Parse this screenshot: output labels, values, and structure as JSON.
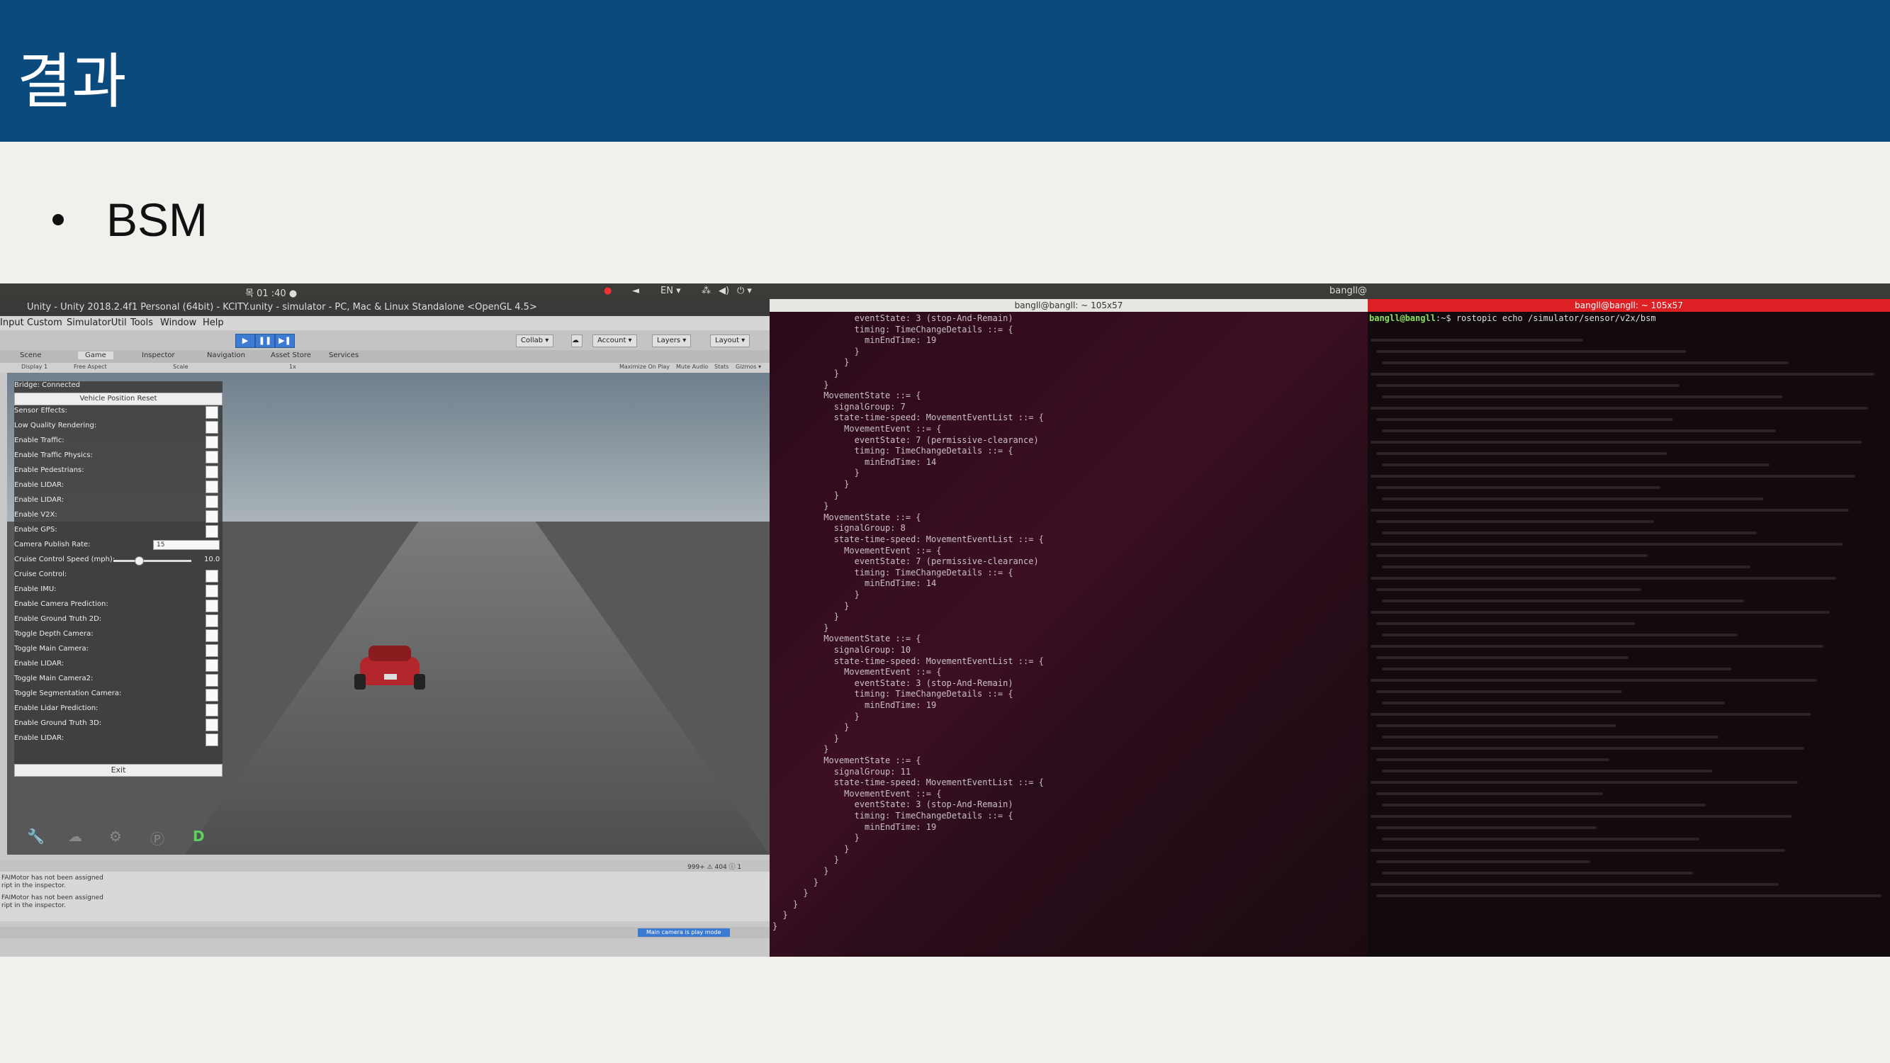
{
  "slide": {
    "title": "결과",
    "bullet": "BSM",
    "colors": {
      "header_bg": "#0b4a7d",
      "slide_bg": "#f2f0ec"
    }
  },
  "system_bar": {
    "clock": "목 01 :40 ●",
    "lang": "EN ▾",
    "right_user": "bangll@"
  },
  "unity": {
    "window_title": "Unity - Unity 2018.2.4f1 Personal (64bit) - KCITY.unity - simulator - PC, Mac & Linux Standalone <OpenGL 4.5>",
    "menu": [
      "Input",
      "Custom",
      "SimulatorUtil",
      "Tools",
      "Window",
      "Help"
    ],
    "toolbar": {
      "play": "▶",
      "pause": "❚❚",
      "step": "▶❚",
      "collab": "Collab ▾",
      "account": "Account ▾",
      "layers": "Layers ▾",
      "layout": "Layout ▾"
    },
    "tabs": [
      "Scene",
      "Game",
      "Inspector",
      "Navigation",
      "Asset Store",
      "Services"
    ],
    "active_tab": "Game",
    "game_sub": {
      "display": "Display 1",
      "aspect": "Free Aspect",
      "scale": "Scale",
      "scale_val": "1x",
      "maximize": "Maximize On Play",
      "mute": "Mute Audio",
      "stats": "Stats",
      "gizmos": "Gizmos ▾"
    },
    "panel": {
      "status": "Bridge: Connected",
      "reset": "Vehicle Position Reset",
      "options_a": [
        "Sensor Effects:",
        "Low Quality Rendering:",
        "Enable Traffic:",
        "Enable Traffic Physics:",
        "Enable Pedestrians:",
        "Enable LIDAR:",
        "Enable LIDAR:",
        "Enable V2X:",
        "Enable GPS:"
      ],
      "rate_label": "Camera Publish Rate:",
      "rate_value": "15",
      "speed_label": "Cruise Control Speed (mph):",
      "speed_value": "10.0",
      "options_b": [
        "Cruise Control:",
        "Enable IMU:",
        "Enable Camera Prediction:",
        "Enable Ground Truth 2D:",
        "Toggle Depth Camera:",
        "Toggle Main Camera:",
        "Enable LIDAR:",
        "Toggle Main Camera2:",
        "Toggle Segmentation Camera:",
        "Enable Lidar Prediction:",
        "Enable Ground Truth 3D:",
        "Enable LIDAR:"
      ],
      "exit": "Exit"
    },
    "bottom_tools": [
      "wrench-icon",
      "cloud-icon",
      "steering-icon",
      "parking-icon",
      "drive-icon"
    ],
    "bottom_tool_glyphs": [
      "🔧",
      "☁",
      "⚙",
      "Ⓟ",
      "D"
    ],
    "console": {
      "lines": [
        "FAIMotor has not been assigned",
        "ript in the inspector.",
        "FAIMotor has not been assigned",
        "ript in the inspector."
      ],
      "counts": "999+  ⚠ 404  ⓘ 1"
    },
    "status_badge": "Main camera is play mode"
  },
  "term1": {
    "title": "bangll@bangll: ~ 105x57",
    "lines": [
      "                eventState: 3 (stop-And-Remain)",
      "                timing: TimeChangeDetails ::= {",
      "                  minEndTime: 19",
      "                }",
      "              }",
      "            }",
      "          }",
      "          MovementState ::= {",
      "            signalGroup: 7",
      "            state-time-speed: MovementEventList ::= {",
      "              MovementEvent ::= {",
      "                eventState: 7 (permissive-clearance)",
      "                timing: TimeChangeDetails ::= {",
      "                  minEndTime: 14",
      "                }",
      "              }",
      "            }",
      "          }",
      "          MovementState ::= {",
      "            signalGroup: 8",
      "            state-time-speed: MovementEventList ::= {",
      "              MovementEvent ::= {",
      "                eventState: 7 (permissive-clearance)",
      "                timing: TimeChangeDetails ::= {",
      "                  minEndTime: 14",
      "                }",
      "              }",
      "            }",
      "          }",
      "          MovementState ::= {",
      "            signalGroup: 10",
      "            state-time-speed: MovementEventList ::= {",
      "              MovementEvent ::= {",
      "                eventState: 3 (stop-And-Remain)",
      "                timing: TimeChangeDetails ::= {",
      "                  minEndTime: 19",
      "                }",
      "              }",
      "            }",
      "          }",
      "          MovementState ::= {",
      "            signalGroup: 11",
      "            state-time-speed: MovementEventList ::= {",
      "              MovementEvent ::= {",
      "                eventState: 3 (stop-And-Remain)",
      "                timing: TimeChangeDetails ::= {",
      "                  minEndTime: 19",
      "                }",
      "              }",
      "            }",
      "          }",
      "        }",
      "      }",
      "    }",
      "  }",
      "}"
    ]
  },
  "term2": {
    "window_label": "bangll@bangll: ~",
    "title": "bangll@bangll: ~ 105x57",
    "prompt_user": "bangll@bangll",
    "prompt_rest": ":~$ rostopic echo /simulator/sensor/v2x/bsm"
  }
}
